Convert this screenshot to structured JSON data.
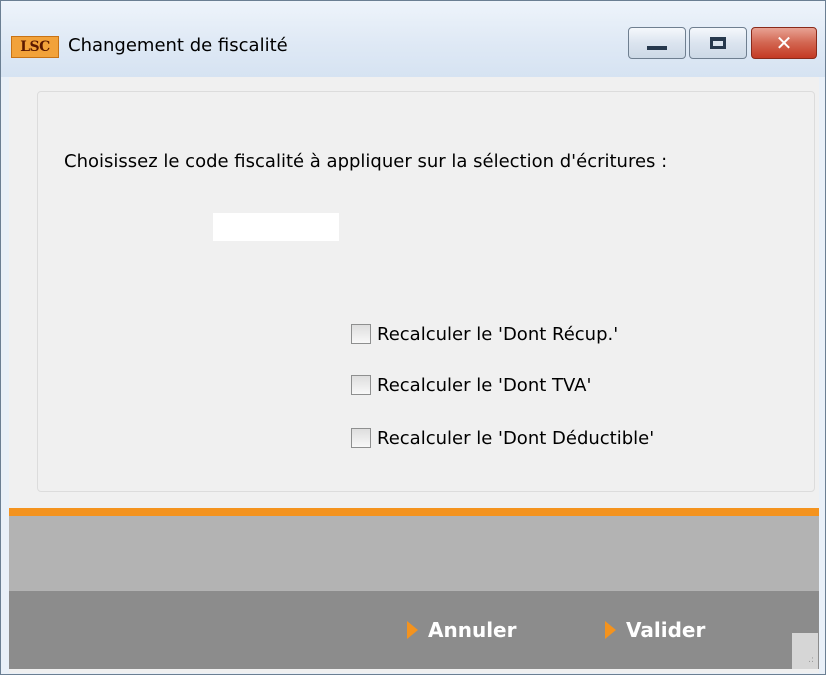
{
  "window": {
    "logo_text": "LSC",
    "title": "Changement de fiscalité",
    "controls": {
      "minimize_icon": "minimize-icon",
      "maximize_icon": "maximize-icon",
      "close_icon": "close-icon",
      "close_glyph": "✕"
    }
  },
  "form": {
    "prompt": "Choisissez le code fiscalité à appliquer sur la sélection d'écritures :",
    "code_value": "",
    "checkboxes": [
      {
        "label": "Recalculer le 'Dont Récup.'",
        "checked": false
      },
      {
        "label": "Recalculer le 'Dont TVA'",
        "checked": false
      },
      {
        "label": "Recalculer le 'Dont Déductible'",
        "checked": false
      }
    ]
  },
  "footer": {
    "cancel_label": "Annuler",
    "validate_label": "Valider"
  },
  "colors": {
    "accent": "#f4931e",
    "footer_bg": "#8c8c8c",
    "band_bg": "#b3b3b3"
  }
}
